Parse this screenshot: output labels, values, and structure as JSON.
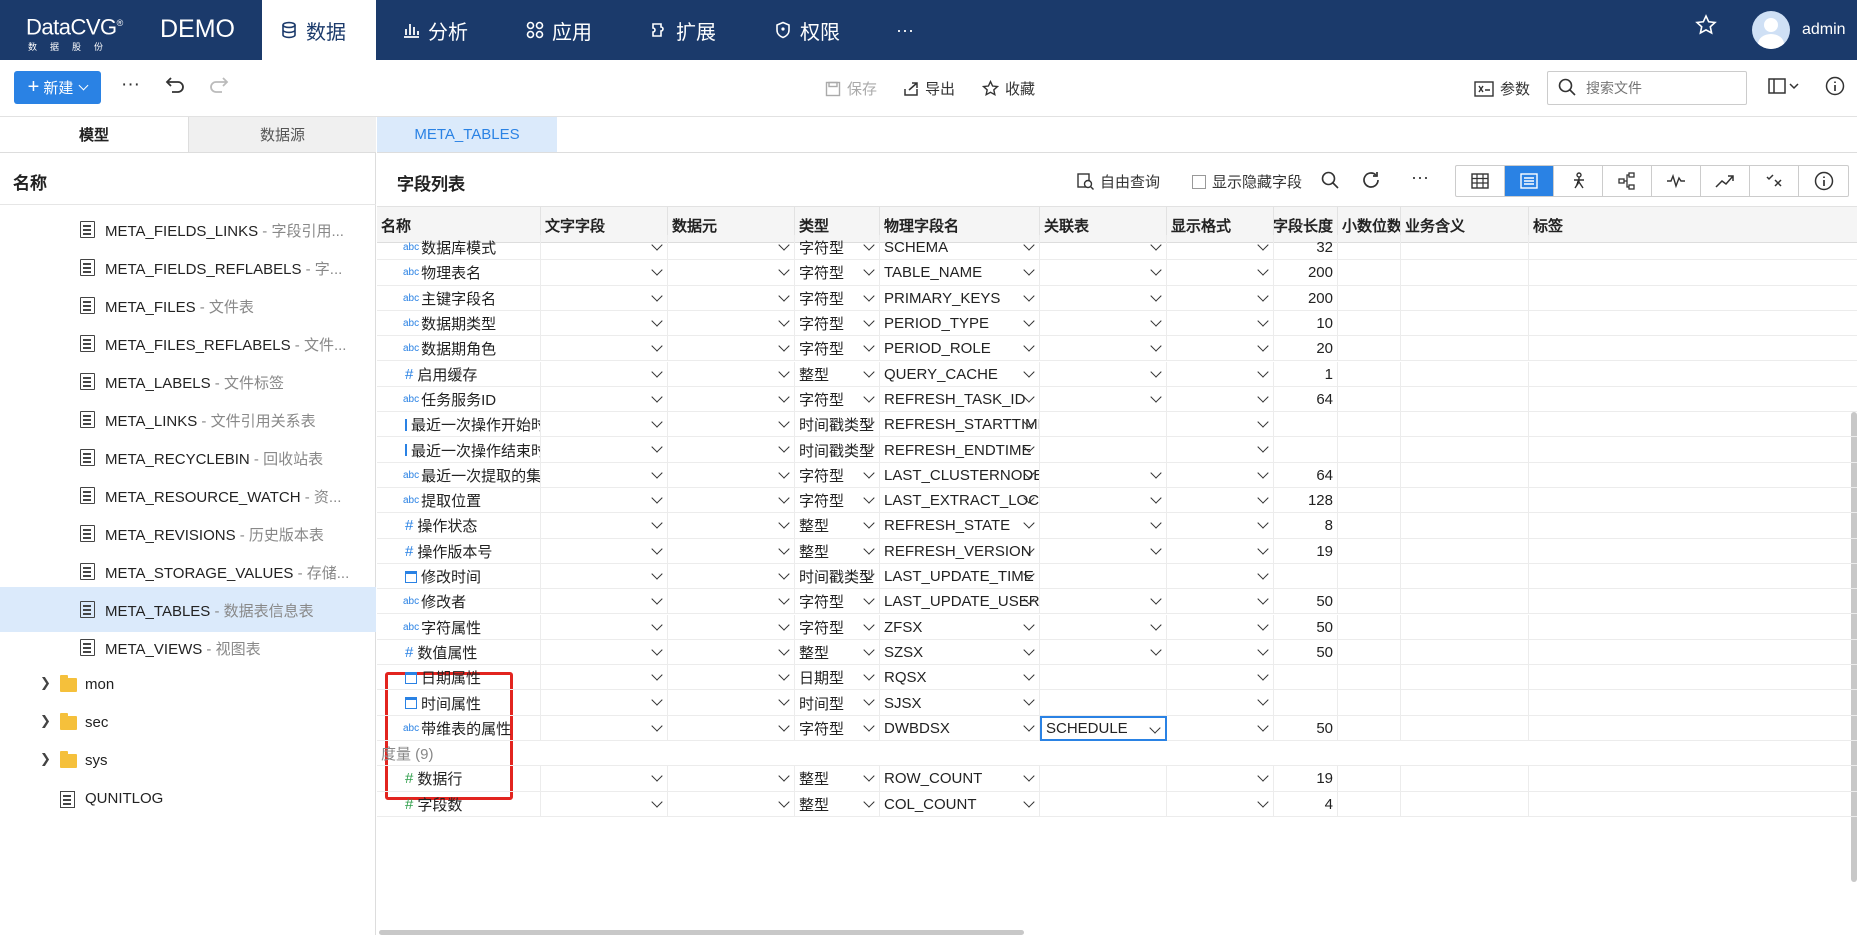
{
  "app": {
    "logo_text": "DataCVG",
    "logo_mark": "®",
    "logo_sub": "数据股份",
    "env_label": "DEMO",
    "nav": [
      {
        "label": "数据",
        "icon": "database-icon",
        "active": true
      },
      {
        "label": "分析",
        "icon": "bar-chart-icon",
        "active": false
      },
      {
        "label": "应用",
        "icon": "apps-icon",
        "active": false
      },
      {
        "label": "扩展",
        "icon": "extension-icon",
        "active": false
      },
      {
        "label": "权限",
        "icon": "shield-icon",
        "active": false
      }
    ],
    "nav_more": "···",
    "user": "admin"
  },
  "toolbar": {
    "new_label": "新建",
    "more": "···",
    "save_label": "保存",
    "export_label": "导出",
    "favorite_label": "收藏",
    "params_label": "参数",
    "search_placeholder": "搜索文件"
  },
  "sidebar": {
    "tabs": [
      "模型",
      "数据源"
    ],
    "header": "名称",
    "items": [
      {
        "name": "META_FIELDS_LINKS",
        "desc": " - 字段引用..."
      },
      {
        "name": "META_FIELDS_REFLABELS",
        "desc": " - 字..."
      },
      {
        "name": "META_FILES",
        "desc": " - 文件表"
      },
      {
        "name": "META_FILES_REFLABELS",
        "desc": " - 文件..."
      },
      {
        "name": "META_LABELS",
        "desc": " - 文件标签"
      },
      {
        "name": "META_LINKS",
        "desc": " - 文件引用关系表"
      },
      {
        "name": "META_RECYCLEBIN",
        "desc": " - 回收站表"
      },
      {
        "name": "META_RESOURCE_WATCH",
        "desc": " - 资..."
      },
      {
        "name": "META_REVISIONS",
        "desc": " - 历史版本表"
      },
      {
        "name": "META_STORAGE_VALUES",
        "desc": " - 存储..."
      },
      {
        "name": "META_TABLES",
        "desc": " - 数据表信息表",
        "selected": true
      },
      {
        "name": "META_VIEWS",
        "desc": " - 视图表"
      }
    ],
    "folders": [
      "mon",
      "sec",
      "sys"
    ],
    "doc_item": "QUNITLOG"
  },
  "main": {
    "tab_label": "META_TABLES",
    "title": "字段列表",
    "free_query": "自由查询",
    "show_hidden": "显示隐藏字段",
    "columns": [
      "名称",
      "文字字段",
      "数据元",
      "类型",
      "物理字段名",
      "关联表",
      "显示格式",
      "字段长度",
      "小数位数",
      "业务含义",
      "标签"
    ],
    "rows": [
      {
        "icon": "abc",
        "name": "数据库模式",
        "type": "字符型",
        "phys": "SCHEMA",
        "len": "32",
        "rel": true
      },
      {
        "icon": "abc",
        "name": "物理表名",
        "type": "字符型",
        "phys": "TABLE_NAME",
        "len": "200",
        "rel": true
      },
      {
        "icon": "abc",
        "name": "主键字段名",
        "type": "字符型",
        "phys": "PRIMARY_KEYS",
        "len": "200",
        "rel": true
      },
      {
        "icon": "abc",
        "name": "数据期类型",
        "type": "字符型",
        "phys": "PERIOD_TYPE",
        "len": "10",
        "rel": true
      },
      {
        "icon": "abc",
        "name": "数据期角色",
        "type": "字符型",
        "phys": "PERIOD_ROLE",
        "len": "20",
        "rel": true
      },
      {
        "icon": "hash",
        "name": "启用缓存",
        "type": "整型",
        "phys": "QUERY_CACHE",
        "len": "1",
        "rel": true
      },
      {
        "icon": "abc",
        "name": "任务服务ID",
        "type": "字符型",
        "phys": "REFRESH_TASK_ID",
        "len": "64",
        "rel": true
      },
      {
        "icon": "cal",
        "name": "最近一次操作开始时间",
        "type": "时间戳类型",
        "phys": "REFRESH_STARTTIME",
        "len": "",
        "rel": false
      },
      {
        "icon": "cal",
        "name": "最近一次操作结束时间",
        "type": "时间戳类型",
        "phys": "REFRESH_ENDTIME",
        "len": "",
        "rel": false
      },
      {
        "icon": "abc",
        "name": "最近一次提取的集群节点",
        "type": "字符型",
        "phys": "LAST_CLUSTERNODE",
        "len": "64",
        "rel": true
      },
      {
        "icon": "abc",
        "name": "提取位置",
        "type": "字符型",
        "phys": "LAST_EXTRACT_LOCATION",
        "len": "128",
        "rel": true
      },
      {
        "icon": "hash",
        "name": "操作状态",
        "type": "整型",
        "phys": "REFRESH_STATE",
        "len": "8",
        "rel": true
      },
      {
        "icon": "hash",
        "name": "操作版本号",
        "type": "整型",
        "phys": "REFRESH_VERSION",
        "len": "19",
        "rel": true
      },
      {
        "icon": "cal",
        "name": "修改时间",
        "type": "时间戳类型",
        "phys": "LAST_UPDATE_TIME",
        "len": "",
        "rel": false
      },
      {
        "icon": "abc",
        "name": "修改者",
        "type": "字符型",
        "phys": "LAST_UPDATE_USERID",
        "len": "50",
        "rel": true
      },
      {
        "icon": "abc",
        "name": "字符属性",
        "type": "字符型",
        "phys": "ZFSX",
        "len": "50",
        "rel": true
      },
      {
        "icon": "hash",
        "name": "数值属性",
        "type": "整型",
        "phys": "SZSX",
        "len": "50",
        "rel": true
      },
      {
        "icon": "cal",
        "name": "日期属性",
        "type": "日期型",
        "phys": "RQSX",
        "len": "",
        "rel": false
      },
      {
        "icon": "cal",
        "name": "时间属性",
        "type": "时间型",
        "phys": "SJSX",
        "len": "",
        "rel": false
      },
      {
        "icon": "abc",
        "name": "带维表的属性",
        "type": "字符型",
        "phys": "DWBDSX",
        "len": "50",
        "rel": true,
        "rel_value": "SCHEDULE",
        "focused": true
      }
    ],
    "group_label": "度量 (9)",
    "measure_rows": [
      {
        "icon": "hash-green",
        "name": "数据行",
        "type": "整型",
        "phys": "ROW_COUNT",
        "len": "19"
      },
      {
        "icon": "hash-green",
        "name": "字段数",
        "type": "整型",
        "phys": "COL_COUNT",
        "len": "4"
      }
    ]
  },
  "colors": {
    "nav_bg": "#1b3a6b",
    "accent": "#2a82e4",
    "selection_bg": "#dbeafb",
    "highlight_border": "#e2241f"
  }
}
